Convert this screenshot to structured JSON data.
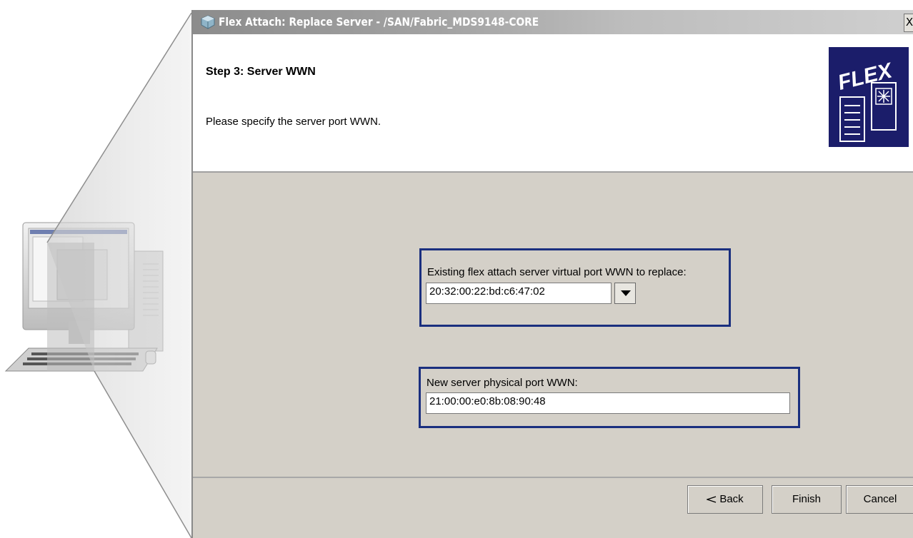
{
  "dialog": {
    "title": "Flex Attach: Replace Server - /SAN/Fabric_MDS9148-CORE",
    "close_glyph": "X",
    "step_title": "Step 3:  Server WWN",
    "step_description": "Please specify the server port WWN."
  },
  "existing_wwn": {
    "label": "Existing flex attach server virtual port WWN to replace:",
    "value": "20:32:00:22:bd:c6:47:02"
  },
  "new_wwn": {
    "label": "New server physical port WWN:",
    "value": "21:00:00:e0:8b:08:90:48"
  },
  "buttons": {
    "back": "Back",
    "finish": "Finish",
    "cancel": "Cancel"
  },
  "icons": {
    "title": "app-icon",
    "logo": "flex-attach-logo",
    "dropdown": "chevron-down-icon",
    "back": "back-arrow-icon"
  },
  "colors": {
    "highlight_border": "#1a2f7f",
    "dialog_bg": "#d4d0c8",
    "logo_bg": "#1b1d6a"
  }
}
